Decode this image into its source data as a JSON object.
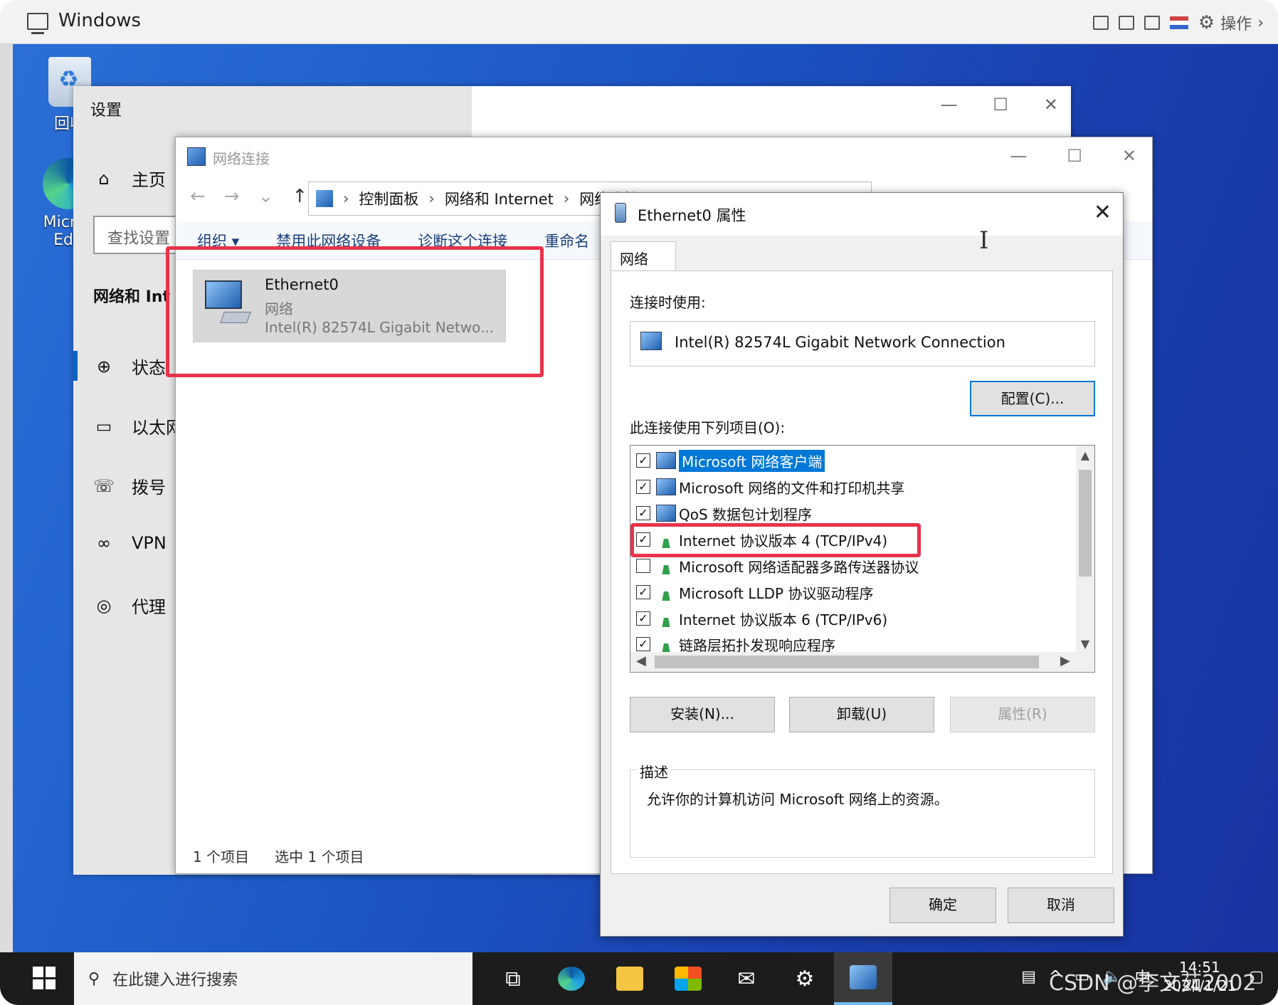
{
  "vm": {
    "title": "Windows",
    "ops_label": "操作"
  },
  "desktop": {
    "recycle_label": "回收",
    "edge_label_1": "Micros",
    "edge_label_2": "Edg"
  },
  "settings": {
    "title": "设置",
    "home": "主页",
    "search_placeholder": "查找设置",
    "section": "网络和 Int",
    "nav": [
      {
        "label": "状态",
        "icon": "globe-status-icon"
      },
      {
        "label": "以太网",
        "icon": "ethernet-icon"
      },
      {
        "label": "拨号",
        "icon": "dialup-icon"
      },
      {
        "label": "VPN",
        "icon": "vpn-icon"
      },
      {
        "label": "代理",
        "icon": "proxy-globe-icon"
      }
    ]
  },
  "netconn": {
    "title": "网络连接",
    "breadcrumb": [
      "控制面板",
      "网络和 Internet",
      "网络连接"
    ],
    "toolbar": [
      "组织 ▾",
      "禁用此网络设备",
      "诊断这个连接",
      "重命名"
    ],
    "adapter": {
      "name": "Ethernet0",
      "type": "网络",
      "description": "Intel(R) 82574L Gigabit Netwo..."
    },
    "status": {
      "count": "1 个项目",
      "selected": "选中 1 个项目"
    }
  },
  "props": {
    "title": "Ethernet0 属性",
    "tab": "网络",
    "connect_using_label": "连接时使用:",
    "adapter": "Intel(R) 82574L Gigabit Network Connection",
    "configure": "配置(C)...",
    "items_label": "此连接使用下列项目(O):",
    "items": [
      {
        "label": "Microsoft 网络客户端",
        "checked": true,
        "icon": "client",
        "selected": true
      },
      {
        "label": "Microsoft 网络的文件和打印机共享",
        "checked": true,
        "icon": "client",
        "selected": false
      },
      {
        "label": "QoS 数据包计划程序",
        "checked": true,
        "icon": "client",
        "selected": false
      },
      {
        "label": "Internet 协议版本 4 (TCP/IPv4)",
        "checked": true,
        "icon": "proto",
        "selected": false
      },
      {
        "label": "Microsoft 网络适配器多路传送器协议",
        "checked": false,
        "icon": "proto",
        "selected": false
      },
      {
        "label": "Microsoft LLDP 协议驱动程序",
        "checked": true,
        "icon": "proto",
        "selected": false
      },
      {
        "label": "Internet 协议版本 6 (TCP/IPv6)",
        "checked": true,
        "icon": "proto",
        "selected": false
      },
      {
        "label": "链路层拓扑发现响应程序",
        "checked": true,
        "icon": "proto",
        "selected": false
      }
    ],
    "install": "安装(N)...",
    "uninstall": "卸载(U)",
    "properties": "属性(R)",
    "desc_legend": "描述",
    "desc_text": "允许你的计算机访问 Microsoft 网络上的资源。",
    "ok": "确定",
    "cancel": "取消"
  },
  "taskbar": {
    "search_placeholder": "在此键入进行搜索",
    "time": "14:51",
    "date": "2024/1/21",
    "ime": "中"
  },
  "watermark": "CSDN @李文茹2002"
}
